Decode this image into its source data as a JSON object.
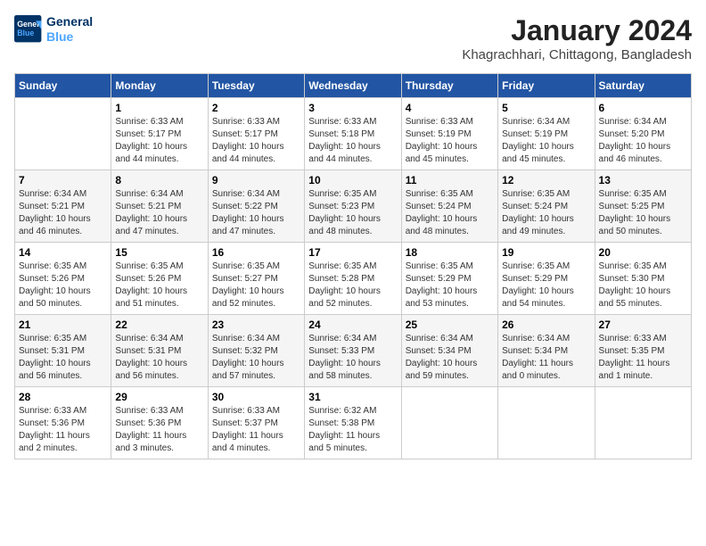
{
  "header": {
    "logo_line1": "General",
    "logo_line2": "Blue",
    "title": "January 2024",
    "subtitle": "Khagrachhari, Chittagong, Bangladesh"
  },
  "days_of_week": [
    "Sunday",
    "Monday",
    "Tuesday",
    "Wednesday",
    "Thursday",
    "Friday",
    "Saturday"
  ],
  "weeks": [
    [
      {
        "day": "",
        "detail": ""
      },
      {
        "day": "1",
        "detail": "Sunrise: 6:33 AM\nSunset: 5:17 PM\nDaylight: 10 hours\nand 44 minutes."
      },
      {
        "day": "2",
        "detail": "Sunrise: 6:33 AM\nSunset: 5:17 PM\nDaylight: 10 hours\nand 44 minutes."
      },
      {
        "day": "3",
        "detail": "Sunrise: 6:33 AM\nSunset: 5:18 PM\nDaylight: 10 hours\nand 44 minutes."
      },
      {
        "day": "4",
        "detail": "Sunrise: 6:33 AM\nSunset: 5:19 PM\nDaylight: 10 hours\nand 45 minutes."
      },
      {
        "day": "5",
        "detail": "Sunrise: 6:34 AM\nSunset: 5:19 PM\nDaylight: 10 hours\nand 45 minutes."
      },
      {
        "day": "6",
        "detail": "Sunrise: 6:34 AM\nSunset: 5:20 PM\nDaylight: 10 hours\nand 46 minutes."
      }
    ],
    [
      {
        "day": "7",
        "detail": "Sunrise: 6:34 AM\nSunset: 5:21 PM\nDaylight: 10 hours\nand 46 minutes."
      },
      {
        "day": "8",
        "detail": "Sunrise: 6:34 AM\nSunset: 5:21 PM\nDaylight: 10 hours\nand 47 minutes."
      },
      {
        "day": "9",
        "detail": "Sunrise: 6:34 AM\nSunset: 5:22 PM\nDaylight: 10 hours\nand 47 minutes."
      },
      {
        "day": "10",
        "detail": "Sunrise: 6:35 AM\nSunset: 5:23 PM\nDaylight: 10 hours\nand 48 minutes."
      },
      {
        "day": "11",
        "detail": "Sunrise: 6:35 AM\nSunset: 5:24 PM\nDaylight: 10 hours\nand 48 minutes."
      },
      {
        "day": "12",
        "detail": "Sunrise: 6:35 AM\nSunset: 5:24 PM\nDaylight: 10 hours\nand 49 minutes."
      },
      {
        "day": "13",
        "detail": "Sunrise: 6:35 AM\nSunset: 5:25 PM\nDaylight: 10 hours\nand 50 minutes."
      }
    ],
    [
      {
        "day": "14",
        "detail": "Sunrise: 6:35 AM\nSunset: 5:26 PM\nDaylight: 10 hours\nand 50 minutes."
      },
      {
        "day": "15",
        "detail": "Sunrise: 6:35 AM\nSunset: 5:26 PM\nDaylight: 10 hours\nand 51 minutes."
      },
      {
        "day": "16",
        "detail": "Sunrise: 6:35 AM\nSunset: 5:27 PM\nDaylight: 10 hours\nand 52 minutes."
      },
      {
        "day": "17",
        "detail": "Sunrise: 6:35 AM\nSunset: 5:28 PM\nDaylight: 10 hours\nand 52 minutes."
      },
      {
        "day": "18",
        "detail": "Sunrise: 6:35 AM\nSunset: 5:29 PM\nDaylight: 10 hours\nand 53 minutes."
      },
      {
        "day": "19",
        "detail": "Sunrise: 6:35 AM\nSunset: 5:29 PM\nDaylight: 10 hours\nand 54 minutes."
      },
      {
        "day": "20",
        "detail": "Sunrise: 6:35 AM\nSunset: 5:30 PM\nDaylight: 10 hours\nand 55 minutes."
      }
    ],
    [
      {
        "day": "21",
        "detail": "Sunrise: 6:35 AM\nSunset: 5:31 PM\nDaylight: 10 hours\nand 56 minutes."
      },
      {
        "day": "22",
        "detail": "Sunrise: 6:34 AM\nSunset: 5:31 PM\nDaylight: 10 hours\nand 56 minutes."
      },
      {
        "day": "23",
        "detail": "Sunrise: 6:34 AM\nSunset: 5:32 PM\nDaylight: 10 hours\nand 57 minutes."
      },
      {
        "day": "24",
        "detail": "Sunrise: 6:34 AM\nSunset: 5:33 PM\nDaylight: 10 hours\nand 58 minutes."
      },
      {
        "day": "25",
        "detail": "Sunrise: 6:34 AM\nSunset: 5:34 PM\nDaylight: 10 hours\nand 59 minutes."
      },
      {
        "day": "26",
        "detail": "Sunrise: 6:34 AM\nSunset: 5:34 PM\nDaylight: 11 hours\nand 0 minutes."
      },
      {
        "day": "27",
        "detail": "Sunrise: 6:33 AM\nSunset: 5:35 PM\nDaylight: 11 hours\nand 1 minute."
      }
    ],
    [
      {
        "day": "28",
        "detail": "Sunrise: 6:33 AM\nSunset: 5:36 PM\nDaylight: 11 hours\nand 2 minutes."
      },
      {
        "day": "29",
        "detail": "Sunrise: 6:33 AM\nSunset: 5:36 PM\nDaylight: 11 hours\nand 3 minutes."
      },
      {
        "day": "30",
        "detail": "Sunrise: 6:33 AM\nSunset: 5:37 PM\nDaylight: 11 hours\nand 4 minutes."
      },
      {
        "day": "31",
        "detail": "Sunrise: 6:32 AM\nSunset: 5:38 PM\nDaylight: 11 hours\nand 5 minutes."
      },
      {
        "day": "",
        "detail": ""
      },
      {
        "day": "",
        "detail": ""
      },
      {
        "day": "",
        "detail": ""
      }
    ]
  ]
}
